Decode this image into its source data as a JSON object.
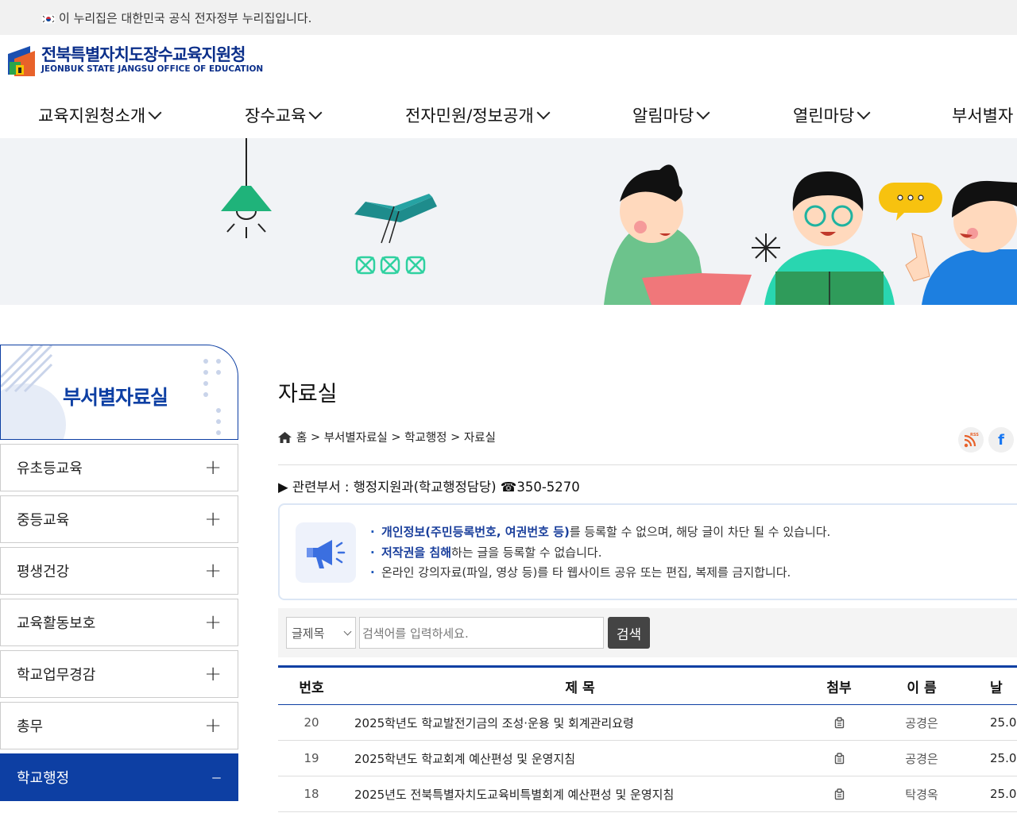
{
  "gov_bar": {
    "text": "이 누리집은 대한민국 공식 전자정부 누리집입니다."
  },
  "logo": {
    "kr": "전북특별자치도장수교육지원청",
    "en": "JEONBUK STATE JANGSU OFFICE OF EDUCATION"
  },
  "gnb": [
    {
      "label": "교육지원청소개"
    },
    {
      "label": "장수교육"
    },
    {
      "label": "전자민원/정보공개"
    },
    {
      "label": "알림마당"
    },
    {
      "label": "열린마당"
    },
    {
      "label": "부서별자"
    }
  ],
  "sidebar": {
    "title": "부서별자료실",
    "items": [
      {
        "label": "유초등교육",
        "icon": "+"
      },
      {
        "label": "중등교육",
        "icon": "+"
      },
      {
        "label": "평생건강",
        "icon": "+"
      },
      {
        "label": "교육활동보호",
        "icon": "+"
      },
      {
        "label": "학교업무경감",
        "icon": "+"
      },
      {
        "label": "총무",
        "icon": "+"
      },
      {
        "label": "학교행정",
        "icon": "–"
      }
    ]
  },
  "page": {
    "title": "자료실",
    "breadcrumb": [
      "홈",
      ">",
      "부서별자료실",
      ">",
      "학교행정",
      ">",
      "자료실"
    ],
    "dept": "▶ 관련부서 : 행정지원과(학교행정담당) ☎350-5270"
  },
  "notice": {
    "line1_strong": "개인정보(주민등록번호, 여권번호 등)",
    "line1_rest": "를 등록할 수 없으며, 해당 글이 차단 될 수 있습니다.",
    "line2_strong": "저작권을 침해",
    "line2_rest": "하는 글을 등록할 수 없습니다.",
    "line3": "온라인 강의자료(파일, 영상 등)를 타 웹사이트 공유 또는 편집, 복제를 금지합니다."
  },
  "search": {
    "select_value": "글제목",
    "placeholder": "검색어를 입력하세요.",
    "button": "검색"
  },
  "table": {
    "headers": {
      "no": "번호",
      "title": "제 목",
      "attach": "첨부",
      "name": "이 름",
      "date": "날"
    },
    "rows": [
      {
        "no": "20",
        "title": "2025학년도 학교발전기금의 조성·운용 및 회계관리요령",
        "name": "공경은",
        "date": "25.0"
      },
      {
        "no": "19",
        "title": "2025학년도 학교회계 예산편성 및 운영지침",
        "name": "공경은",
        "date": "25.0"
      },
      {
        "no": "18",
        "title": "2025년도 전북특별자치도교육비특별회계 예산편성 및 운영지침",
        "name": "탁경옥",
        "date": "25.0"
      }
    ]
  },
  "share": {
    "rss": "RSS",
    "facebook": "f"
  },
  "colors": {
    "brand": "#0d3fa3",
    "notice_border": "#dbe6f5",
    "banner_bg": "#f1f3f6"
  }
}
